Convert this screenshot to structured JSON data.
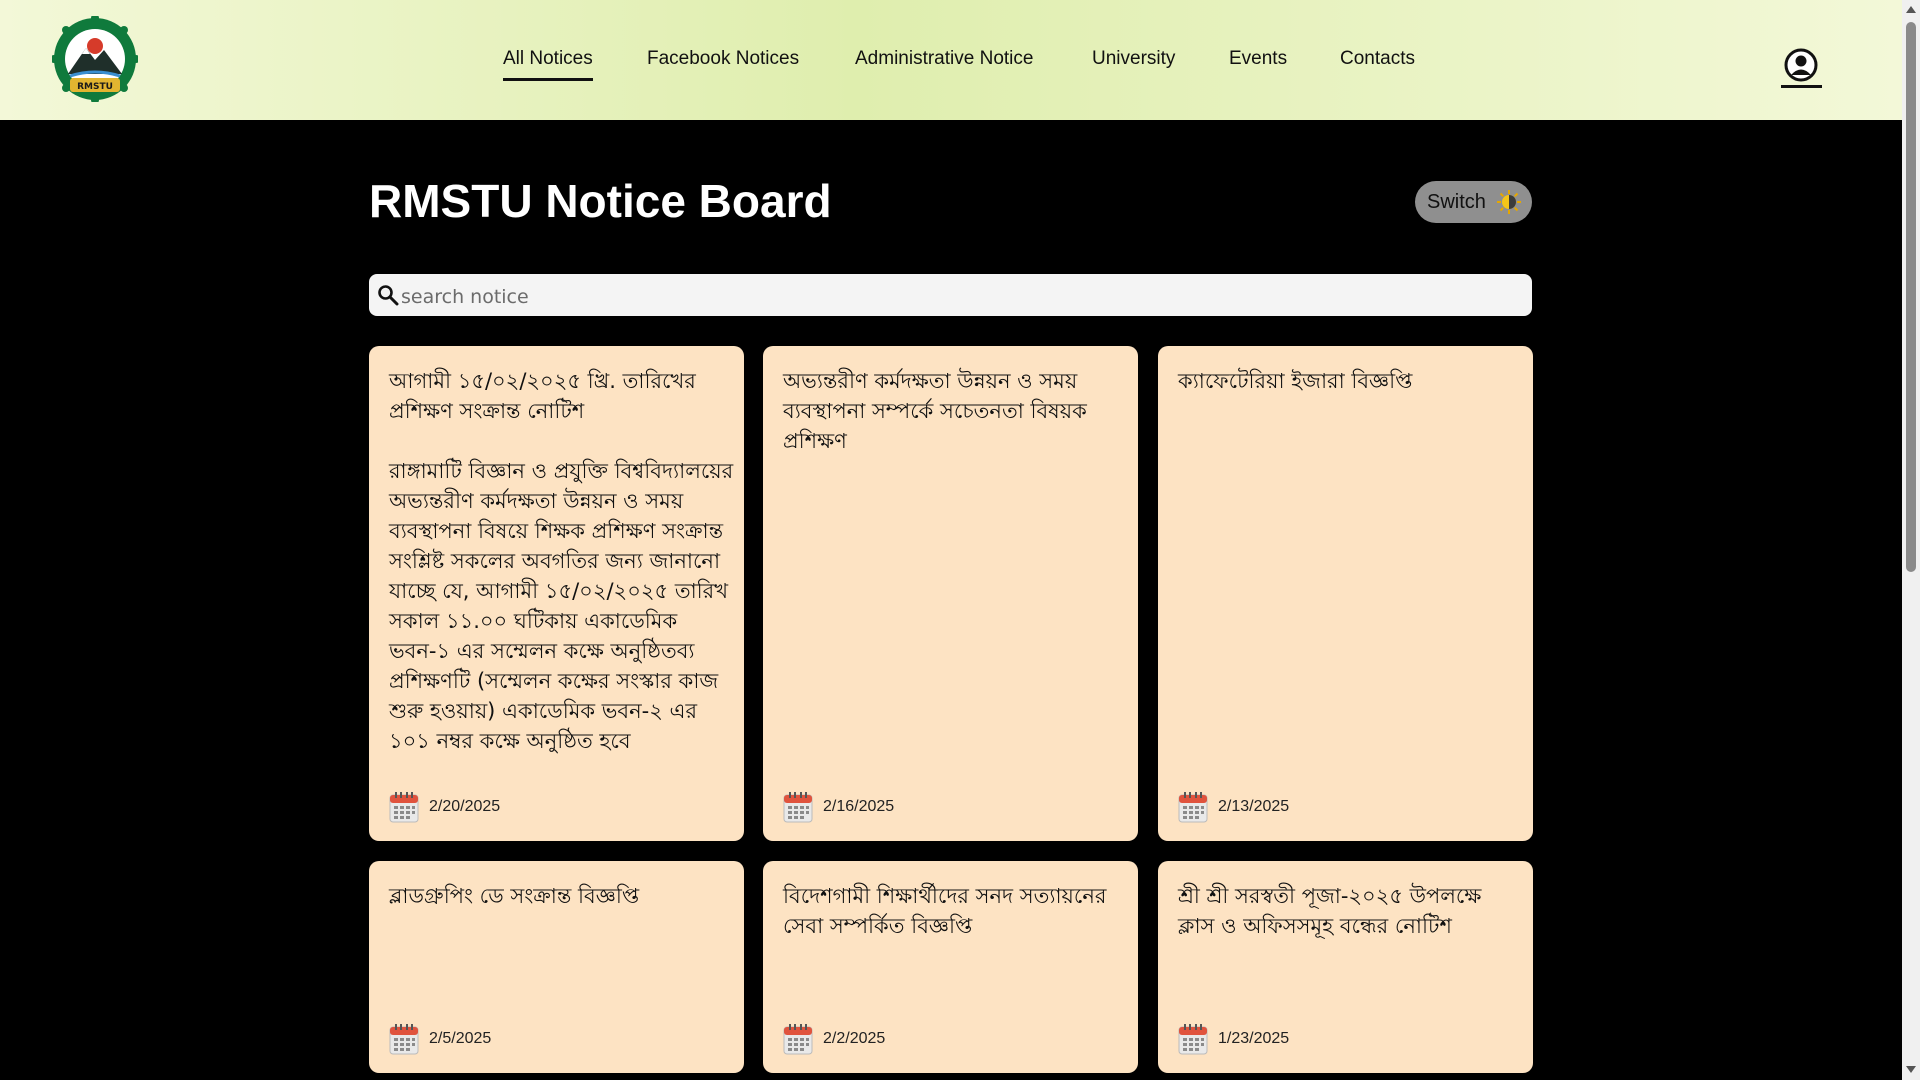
{
  "nav": {
    "items": [
      {
        "label": "All Notices",
        "active": true
      },
      {
        "label": "Facebook Notices",
        "active": false
      },
      {
        "label": "Administrative Notice",
        "active": false
      },
      {
        "label": "University",
        "active": false
      },
      {
        "label": "Events",
        "active": false
      },
      {
        "label": "Contacts",
        "active": false
      }
    ],
    "logo_text": "RMSTU"
  },
  "header": {
    "title": "RMSTU Notice Board",
    "switch_label": "Switch"
  },
  "search": {
    "placeholder": "search notice",
    "value": ""
  },
  "notices": [
    {
      "title": "আগামী ১৫/০২/২০২৫ খ্রি. তারিখের প্রশিক্ষণ সংক্রান্ত নোটিশ",
      "body": "রাঙ্গামাটি বিজ্ঞান ও প্রযুক্তি বিশ্ববিদ্যালয়ের অভ্যন্তরীণ কর্মদক্ষতা উন্নয়ন ও সময় ব্যবস্থাপনা বিষয়ে শিক্ষক প্রশিক্ষণ সংক্রান্ত সংশ্লিষ্ট সকলের অবগতির জন্য জানানো যাচ্ছে যে, আগামী ১৫/০২/২০২৫ তারিখ সকাল ১১.০০ ঘটিকায় একাডেমিক ভবন-১ এর সম্মেলন কক্ষে অনুষ্ঠিতব্য প্রশিক্ষণটি (সম্মেলন কক্ষের সংস্কার কাজ শুরু হওয়ায়) একাডেমিক ভবন-২ এর ১০১ নম্বর কক্ষে অনুষ্ঠিত হবে",
      "date": "2/20/2025"
    },
    {
      "title": "অভ্যন্তরীণ কর্মদক্ষতা উন্নয়ন ও সময় ব্যবস্থাপনা সম্পর্কে সচেতনতা বিষয়ক প্রশিক্ষণ",
      "body": "",
      "date": "2/16/2025"
    },
    {
      "title": "ক্যাফেটেরিয়া ইজারা বিজ্ঞপ্তি",
      "body": "",
      "date": "2/13/2025"
    },
    {
      "title": "ব্লাডগ্রুপিং ডে সংক্রান্ত বিজ্ঞপ্তি",
      "body": "",
      "date": "2/5/2025"
    },
    {
      "title": "বিদেশগামী শিক্ষার্থীদের সনদ সত্যায়নের সেবা সম্পর্কিত বিজ্ঞপ্তি",
      "body": "",
      "date": "2/2/2025"
    },
    {
      "title": "শ্রী শ্রী সরস্বতী পূজা-২০২৫ উপলক্ষে ক্লাস ও অফিসসমূহ বন্ধের নোটিশ",
      "body": "",
      "date": "1/23/2025"
    }
  ],
  "colors": {
    "card_bg": "#fde3c3",
    "page_bg": "#000000",
    "header_bg": "#dfeeae",
    "logo_green": "#0f7a3c",
    "logo_gold": "#e2b530"
  },
  "icons": [
    "logo-icon",
    "user-icon",
    "sun-icon",
    "search-icon",
    "calendar-icon"
  ]
}
